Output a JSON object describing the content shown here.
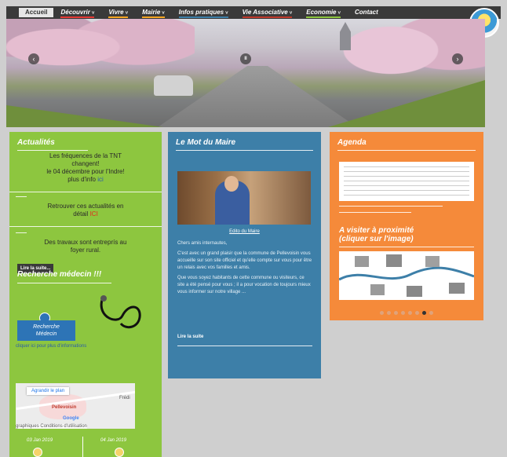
{
  "nav": {
    "items": [
      {
        "label": "Accueil",
        "chev": "",
        "color": ""
      },
      {
        "label": "Découvrir",
        "chev": "˅",
        "color": "#e53935"
      },
      {
        "label": "Vivre",
        "chev": "˅",
        "color": "#f5a623"
      },
      {
        "label": "Mairie",
        "chev": "˅",
        "color": "#f5a623"
      },
      {
        "label": "Infos pratiques",
        "chev": "˅",
        "color": "#3d7fa8"
      },
      {
        "label": "Vie Associative",
        "chev": "˅",
        "color": "#c0392b"
      },
      {
        "label": "Economie",
        "chev": "˅",
        "color": "#8dc63f"
      },
      {
        "label": "Contact",
        "chev": "",
        "color": ""
      }
    ]
  },
  "hero": {
    "prev": "‹",
    "pause": "II",
    "next": "›"
  },
  "actualites": {
    "title": "Actualités",
    "item1_l1": "Les  fréquences de la TNT",
    "item1_l2": "changent!",
    "item1_l3": "le 04 décembre pour l'Indre!",
    "item1_l4": "plus d'info ",
    "item1_link": "ici",
    "item2_l1": "Retrouver ces actualités en",
    "item2_l2": "détail ",
    "item2_link": "ICI",
    "item3_l1": "Des travaux sont entreprís au",
    "item3_l2": "foyer rural.",
    "read_more": "Lire la suite..."
  },
  "medecin": {
    "title": "Recherche médecin !!!",
    "badge_l1": "Recherche",
    "badge_l2": "Médecin",
    "link": "cliquer ici pour plus d'informations"
  },
  "map": {
    "enlarge": "Agrandir le plan",
    "town": "Pellevoisin",
    "near": "Frédi",
    "google": "Google",
    "footer": "graphiques    Conditions d'utilisation"
  },
  "dates": {
    "d1": "03 Jan 2019",
    "d2": "04 Jan 2019"
  },
  "maire": {
    "title": "Le Mot du Maire",
    "caption": "Edito du Maire",
    "body": [
      "Chers amis internautes,",
      "C'est avec un grand plaisir que la commune de Pellevoisin vous accueille sur son site officiel et qu'elle compte sur vous pour être un relais avec vos familles et amis.",
      "Que vous soyez habitants de cette commune ou visiteurs, ce site a été pensé pour vous ; il a pour vocation de toujours mieux vous informer sur notre village ..."
    ],
    "read_more": "Lire la suite"
  },
  "agenda": {
    "title": "Agenda",
    "visit_title_l1": "A visiter à proximité",
    "visit_title_l2": "(cliquer sur l'image)",
    "dots_count": 8,
    "active_dot": 6
  }
}
